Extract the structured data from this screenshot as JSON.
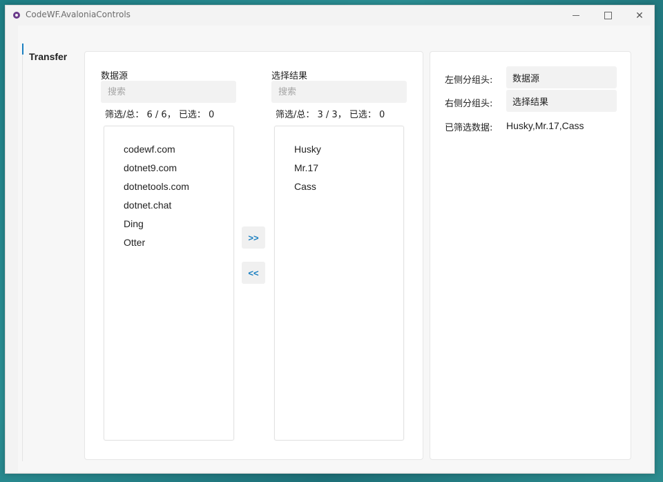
{
  "window": {
    "title": "CodeWF.AvaloniaControls"
  },
  "nav": {
    "active_item": "Transfer"
  },
  "left": {
    "header": "数据源",
    "search_placeholder": "搜索",
    "stats": "筛选/总： 6 / 6， 已选： 0",
    "items": [
      "codewf.com",
      "dotnet9.com",
      "dotnetools.com",
      "dotnet.chat",
      "Ding",
      "Otter"
    ]
  },
  "right": {
    "header": "选择结果",
    "search_placeholder": "搜索",
    "stats": "筛选/总： 3 / 3， 已选： 0",
    "items": [
      "Husky",
      "Mr.17",
      "Cass"
    ]
  },
  "buttons": {
    "move_right": ">>",
    "move_left": "<<"
  },
  "settings": {
    "left_header_label": "左侧分组头:",
    "left_header_value": "数据源",
    "right_header_label": "右侧分组头:",
    "right_header_value": "选择结果",
    "filtered_label": "已筛选数据:",
    "filtered_value": "Husky,Mr.17,Cass"
  },
  "colors": {
    "accent": "#1a7fc1",
    "background": "#f3f3f3"
  }
}
